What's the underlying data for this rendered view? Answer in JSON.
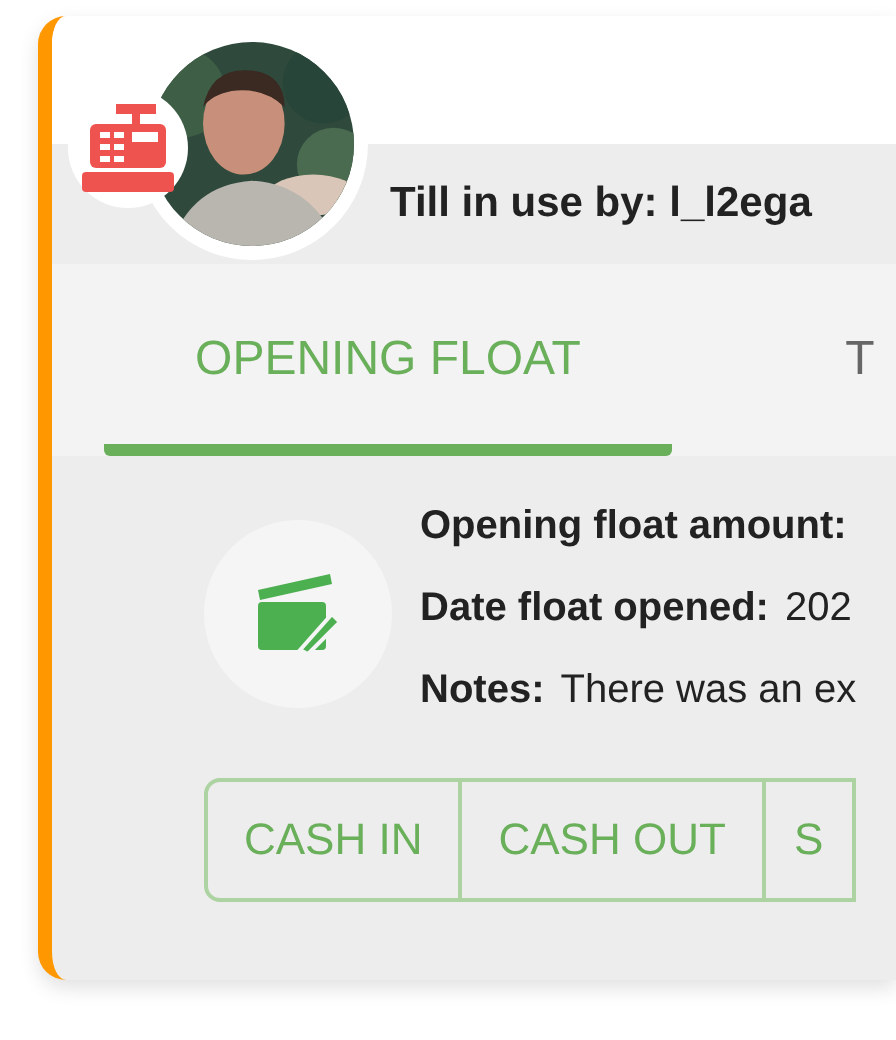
{
  "header": {
    "label": "Till in use by:",
    "user": "l_l2ega"
  },
  "tabs": [
    {
      "label": "OPENING FLOAT",
      "selected": true
    },
    {
      "label": "T",
      "selected": false
    }
  ],
  "details": [
    {
      "label": "Opening float amount:"
    },
    {
      "label": "Date float opened:",
      "value": "202"
    },
    {
      "label": "Notes:",
      "value": "There was an ex"
    }
  ],
  "actions": [
    "CASH IN",
    "CASH OUT",
    "S"
  ]
}
